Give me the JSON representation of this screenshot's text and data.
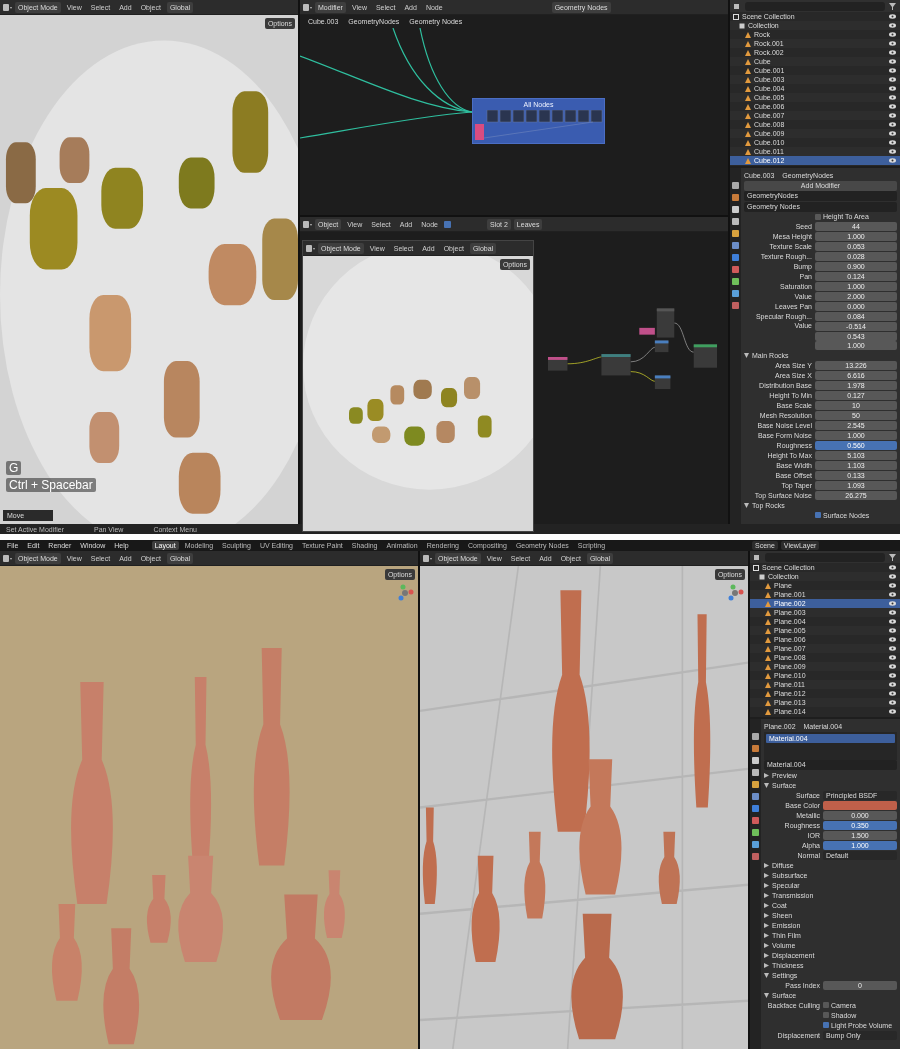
{
  "top": {
    "viewport": {
      "header": {
        "mode": "Object Mode",
        "menus": [
          "View",
          "Select",
          "Add",
          "Object"
        ],
        "orientation": "Global"
      },
      "options": "Options",
      "hints": [
        "G",
        "Ctrl + Spacebar"
      ],
      "operator": "Move"
    },
    "node_editor": {
      "header": {
        "editor": "Modifier",
        "menus": [
          "View",
          "Select",
          "Add",
          "Node"
        ],
        "node_group": "Geometry Nodes"
      },
      "breadcrumbs": [
        "Cube.003",
        "GeometryNodes",
        "Geometry Nodes"
      ],
      "frame_label": "All Nodes"
    },
    "shader_editor": {
      "header": {
        "editor": "Object",
        "menus": [
          "View",
          "Select",
          "Add",
          "Node"
        ],
        "use_nodes": true,
        "slot": "Slot 2",
        "material": "Leaves"
      }
    },
    "preview_viewport": {
      "header": {
        "mode": "Object Mode",
        "menus": [
          "View",
          "Select",
          "Add",
          "Object"
        ],
        "orientation": "Global"
      },
      "options": "Options"
    },
    "outliner": {
      "items": [
        {
          "label": "Scene Collection",
          "selected": false,
          "children": [
            {
              "label": "Collection",
              "selected": false,
              "children": [
                {
                  "label": "Rock",
                  "selected": false
                },
                {
                  "label": "Rock.001",
                  "selected": false
                },
                {
                  "label": "Rock.002",
                  "selected": false
                },
                {
                  "label": "Cube",
                  "selected": false
                },
                {
                  "label": "Cube.001",
                  "selected": false
                },
                {
                  "label": "Cube.003",
                  "selected": false
                },
                {
                  "label": "Cube.004",
                  "selected": false
                },
                {
                  "label": "Cube.005",
                  "selected": false
                },
                {
                  "label": "Cube.006",
                  "selected": false
                },
                {
                  "label": "Cube.007",
                  "selected": false
                },
                {
                  "label": "Cube.008",
                  "selected": false
                },
                {
                  "label": "Cube.009",
                  "selected": false
                },
                {
                  "label": "Cube.010",
                  "selected": false
                },
                {
                  "label": "Cube.011",
                  "selected": false
                },
                {
                  "label": "Cube.012",
                  "selected": true
                }
              ]
            }
          ]
        }
      ]
    },
    "properties": {
      "breadcrumbs": [
        "Cube.003",
        "GeometryNodes"
      ],
      "button": "Add Modifier",
      "modifier": {
        "name": "GeometryNodes",
        "node_group": "Geometry Nodes"
      },
      "rows": [
        {
          "kind": "checkbox",
          "label": "Height To Area",
          "checked": false
        },
        {
          "kind": "field",
          "label": "Seed",
          "value": "44",
          "highlighted": false
        },
        {
          "kind": "field",
          "label": "Mesa Height",
          "value": "1.000",
          "highlighted": false
        },
        {
          "kind": "field",
          "label": "Texture Scale",
          "value": "0.053",
          "highlighted": false
        },
        {
          "kind": "field",
          "label": "Texture Rough...",
          "value": "0.028",
          "highlighted": false
        },
        {
          "kind": "field",
          "label": "Bump",
          "value": "0.900",
          "highlighted": false
        },
        {
          "kind": "field",
          "label": "Pan",
          "value": "0.124",
          "highlighted": false
        },
        {
          "kind": "field",
          "label": "Saturation",
          "value": "1.000",
          "highlighted": false
        },
        {
          "kind": "field",
          "label": "Value",
          "value": "2.000",
          "highlighted": false
        },
        {
          "kind": "field",
          "label": "Leaves Pan",
          "value": "0.000",
          "highlighted": false
        },
        {
          "kind": "field",
          "label": "Specular Rough...",
          "value": "0.084",
          "highlighted": false
        },
        {
          "kind": "vector",
          "label": "Value",
          "values": [
            "-0.514",
            "0.543",
            "1.000"
          ]
        },
        {
          "kind": "section",
          "label": "Main Rocks",
          "expanded": true
        },
        {
          "kind": "field",
          "label": "Area Size Y",
          "value": "13.226",
          "highlighted": false
        },
        {
          "kind": "field",
          "label": "Area Size X",
          "value": "6.616",
          "highlighted": false
        },
        {
          "kind": "field",
          "label": "Distribution Base",
          "value": "1.978",
          "highlighted": false
        },
        {
          "kind": "field",
          "label": "Height To Min",
          "value": "0.127",
          "highlighted": false
        },
        {
          "kind": "field",
          "label": "Base Scale",
          "value": "10",
          "highlighted": false
        },
        {
          "kind": "field",
          "label": "Mesh Resolution",
          "value": "50",
          "highlighted": false
        },
        {
          "kind": "field",
          "label": "Base Noise Level",
          "value": "2.545",
          "highlighted": false
        },
        {
          "kind": "field",
          "label": "Base Form Noise",
          "value": "1.000",
          "highlighted": false
        },
        {
          "kind": "field",
          "label": "Roughness",
          "value": "0.560",
          "highlighted": true
        },
        {
          "kind": "field",
          "label": "Height To Max",
          "value": "5.103",
          "highlighted": false
        },
        {
          "kind": "field",
          "label": "Base Width",
          "value": "1.103",
          "highlighted": false
        },
        {
          "kind": "field",
          "label": "Base Offset",
          "value": "0.133",
          "highlighted": false
        },
        {
          "kind": "field",
          "label": "Top Taper",
          "value": "1.093",
          "highlighted": false
        },
        {
          "kind": "field",
          "label": "Top Surface Noise",
          "value": "26.275",
          "highlighted": false
        },
        {
          "kind": "section",
          "label": "Top Rocks",
          "expanded": true
        },
        {
          "kind": "checkbox",
          "label": "Surface Nodes",
          "checked": true
        }
      ]
    },
    "status_bar": [
      "Set Active Modifier",
      "Pan View",
      "Context Menu"
    ]
  },
  "bottom": {
    "topbar": {
      "menus": [
        "File",
        "Edit",
        "Render",
        "Window",
        "Help"
      ],
      "tabs": [
        {
          "label": "Layout",
          "selected": true
        },
        {
          "label": "Modeling",
          "selected": false
        },
        {
          "label": "Sculpting",
          "selected": false
        },
        {
          "label": "UV Editing",
          "selected": false
        },
        {
          "label": "Texture Paint",
          "selected": false
        },
        {
          "label": "Shading",
          "selected": false
        },
        {
          "label": "Animation",
          "selected": false
        },
        {
          "label": "Rendering",
          "selected": false
        },
        {
          "label": "Compositing",
          "selected": false
        },
        {
          "label": "Geometry Nodes",
          "selected": false
        },
        {
          "label": "Scripting",
          "selected": false
        }
      ],
      "scene": "Scene",
      "view_layer": "ViewLayer"
    },
    "left_viewport": {
      "header": {
        "mode": "Object Mode",
        "menus": [
          "View",
          "Select",
          "Add",
          "Object"
        ],
        "orientation": "Global"
      },
      "options": "Options"
    },
    "right_viewport": {
      "header": {
        "mode": "Object Mode",
        "menus": [
          "View",
          "Select",
          "Add",
          "Object"
        ],
        "orientation": "Global"
      },
      "options": "Options"
    },
    "outliner": {
      "items": [
        {
          "label": "Scene Collection",
          "selected": false,
          "children": [
            {
              "label": "Collection",
              "selected": false,
              "children": [
                {
                  "label": "Plane",
                  "selected": false
                },
                {
                  "label": "Plane.001",
                  "selected": false
                },
                {
                  "label": "Plane.002",
                  "selected": true
                },
                {
                  "label": "Plane.003",
                  "selected": false
                },
                {
                  "label": "Plane.004",
                  "selected": false
                },
                {
                  "label": "Plane.005",
                  "selected": false
                },
                {
                  "label": "Plane.006",
                  "selected": false
                },
                {
                  "label": "Plane.007",
                  "selected": false
                },
                {
                  "label": "Plane.008",
                  "selected": false
                },
                {
                  "label": "Plane.009",
                  "selected": false
                },
                {
                  "label": "Plane.010",
                  "selected": false
                },
                {
                  "label": "Plane.011",
                  "selected": false
                },
                {
                  "label": "Plane.012",
                  "selected": false
                },
                {
                  "label": "Plane.013",
                  "selected": false
                },
                {
                  "label": "Plane.014",
                  "selected": false
                }
              ]
            }
          ]
        }
      ]
    },
    "properties": {
      "breadcrumbs": [
        "Plane.002",
        "Material.004"
      ],
      "slots": [
        {
          "label": "Material.004",
          "selected": true
        }
      ],
      "material": "Material.004",
      "rows": [
        {
          "kind": "section",
          "label": "Preview",
          "expanded": false
        },
        {
          "kind": "section",
          "label": "Surface",
          "expanded": true
        },
        {
          "kind": "dropdown",
          "label": "Surface",
          "value": "Principled BSDF"
        },
        {
          "kind": "color",
          "label": "Base Color",
          "color": "#c0604a"
        },
        {
          "kind": "field",
          "label": "Metallic",
          "value": "0.000",
          "highlighted": false
        },
        {
          "kind": "field",
          "label": "Roughness",
          "value": "0.350",
          "highlighted": true
        },
        {
          "kind": "field",
          "label": "IOR",
          "value": "1.500",
          "highlighted": false
        },
        {
          "kind": "field",
          "label": "Alpha",
          "value": "1.000",
          "highlighted": true
        },
        {
          "kind": "dropdown",
          "label": "Normal",
          "value": "Default"
        },
        {
          "kind": "section",
          "label": "Diffuse",
          "expanded": false
        },
        {
          "kind": "section",
          "label": "Subsurface",
          "expanded": false
        },
        {
          "kind": "section",
          "label": "Specular",
          "expanded": false
        },
        {
          "kind": "section",
          "label": "Transmission",
          "expanded": false
        },
        {
          "kind": "section",
          "label": "Coat",
          "expanded": false
        },
        {
          "kind": "section",
          "label": "Sheen",
          "expanded": false
        },
        {
          "kind": "section",
          "label": "Emission",
          "expanded": false
        },
        {
          "kind": "section",
          "label": "Thin Film",
          "expanded": false
        },
        {
          "kind": "section",
          "label": "Volume",
          "expanded": false
        },
        {
          "kind": "section",
          "label": "Displacement",
          "expanded": false
        },
        {
          "kind": "section",
          "label": "Thickness",
          "expanded": false
        },
        {
          "kind": "section",
          "label": "Settings",
          "expanded": true
        },
        {
          "kind": "field",
          "label": "Pass Index",
          "value": "0",
          "highlighted": false
        },
        {
          "kind": "section",
          "label": "Surface",
          "expanded": true
        },
        {
          "kind": "checkbox",
          "heading": "Backface Culling",
          "label": "Camera",
          "checked": false
        },
        {
          "kind": "checkbox",
          "label": "Shadow",
          "checked": false
        },
        {
          "kind": "checkbox",
          "label": "Light Probe Volume",
          "checked": true
        },
        {
          "kind": "dropdown",
          "label": "Displacement",
          "value": "Bump Only"
        }
      ]
    }
  }
}
